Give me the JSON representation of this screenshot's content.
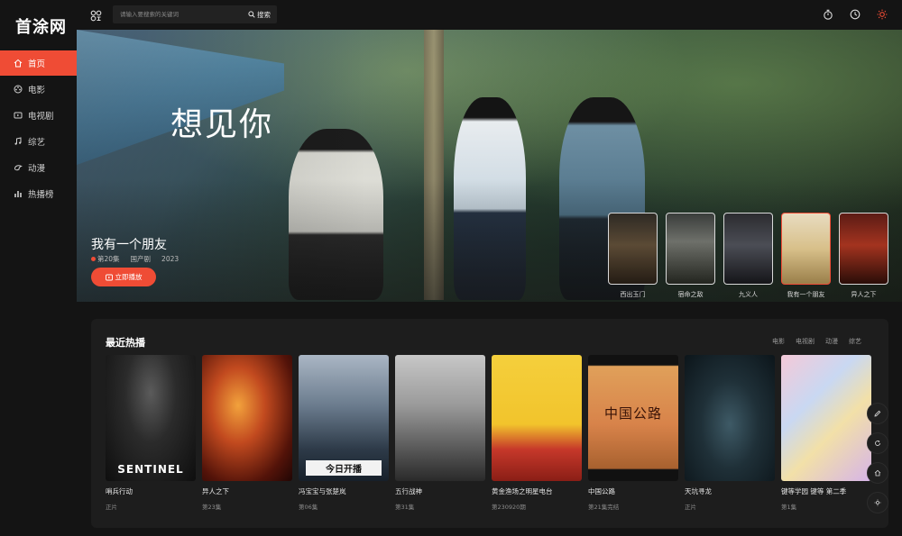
{
  "app": {
    "logo": "首涂网"
  },
  "search": {
    "placeholder": "请输入要搜索的关键词",
    "button_label": "搜索"
  },
  "sidebar": {
    "items": [
      {
        "label": "首页",
        "icon": "home-icon",
        "active": true
      },
      {
        "label": "电影",
        "icon": "film-reel-icon"
      },
      {
        "label": "电视剧",
        "icon": "tv-icon"
      },
      {
        "label": "综艺",
        "icon": "music-note-icon"
      },
      {
        "label": "动漫",
        "icon": "anime-icon"
      },
      {
        "label": "热播榜",
        "icon": "chart-bars-icon"
      }
    ]
  },
  "banner": {
    "calligraphy": "想见你",
    "title": "我有一个朋友",
    "episode": "第20集",
    "region": "国产剧",
    "year": "2023",
    "play_label": "立即播放",
    "thumbs": [
      {
        "label": "西出玉门"
      },
      {
        "label": "宿命之敌"
      },
      {
        "label": "九义人"
      },
      {
        "label": "我有一个朋友",
        "active": true
      },
      {
        "label": "异人之下"
      }
    ]
  },
  "section": {
    "title": "最近热播",
    "tabs": [
      "电影",
      "电视剧",
      "动漫",
      "综艺"
    ],
    "cards": [
      {
        "title": "哨兵行动",
        "sub": "正片",
        "poster_text": "SENTINEL"
      },
      {
        "title": "异人之下",
        "sub": "第23集",
        "poster_text": ""
      },
      {
        "title": "冯宝宝与张楚岚",
        "sub": "第06集",
        "poster_text": "今日开播"
      },
      {
        "title": "五行战神",
        "sub": "第31集",
        "poster_text": ""
      },
      {
        "title": "黄金渔场之明星电台",
        "sub": "第230920期",
        "poster_text": ""
      },
      {
        "title": "中国公路",
        "sub": "第21集完结",
        "poster_text": "中国公路"
      },
      {
        "title": "天坑寻龙",
        "sub": "正片",
        "poster_text": ""
      },
      {
        "title": "键等学园 键等 第二季",
        "sub": "第1集",
        "poster_text": ""
      }
    ]
  },
  "colors": {
    "accent": "#ef4c35",
    "background": "#141414",
    "panel": "#1d1d1d"
  }
}
